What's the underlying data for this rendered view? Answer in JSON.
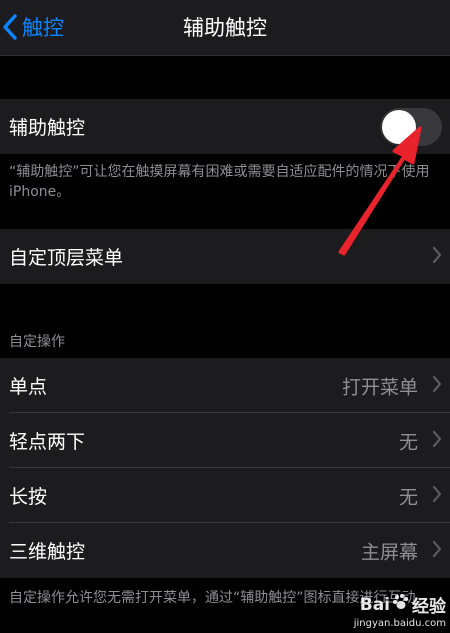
{
  "navbar": {
    "back_label": "触控",
    "title": "辅助触控"
  },
  "assistive_touch": {
    "label": "辅助触控",
    "enabled": false,
    "footnote": "“辅助触控”可让您在触摸屏幕有困难或需要自适应配件的情况下使用iPhone。"
  },
  "top_menu": {
    "label": "自定顶层菜单"
  },
  "custom_actions": {
    "header": "自定操作",
    "rows": [
      {
        "label": "单点",
        "value": "打开菜单"
      },
      {
        "label": "轻点两下",
        "value": "无"
      },
      {
        "label": "长按",
        "value": "无"
      },
      {
        "label": "三维触控",
        "value": "主屏幕"
      }
    ],
    "footnote": "自定操作允许您无需打开菜单，通过“辅助触控”图标直接进行互动。"
  },
  "watermark": {
    "brand_a": "Bai",
    "brand_b": "经验",
    "url": "jingyan.baidu.com"
  },
  "colors": {
    "accent": "#0a84ff",
    "annotation_arrow": "#e8232b",
    "cell_background": "#1c1c1e",
    "secondary_text": "#8e8e93"
  },
  "icons": [
    "chevron-left-icon",
    "chevron-right-icon",
    "red-arrow-annotation",
    "baidu-paw-icon"
  ]
}
